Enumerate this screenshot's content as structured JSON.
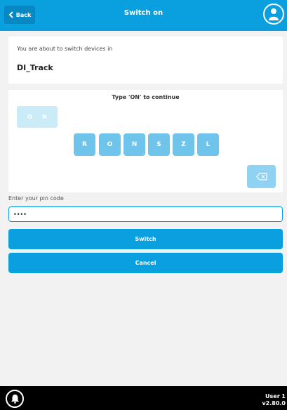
{
  "header": {
    "back_label": "Back",
    "title": "Switch on",
    "back_icon": "chevron-left-icon",
    "user_icon": "user-icon",
    "color": "#0aa0df"
  },
  "info": {
    "text": "You are about to switch devices in",
    "device": "DI_Track"
  },
  "code": {
    "title": "Type 'ON' to continue",
    "typed": [
      "O",
      "N"
    ],
    "keys": [
      "R",
      "O",
      "N",
      "S",
      "Z",
      "L"
    ],
    "backspace_icon": "backspace-icon"
  },
  "pin": {
    "label": "Enter your pin code",
    "value": "••••"
  },
  "actions": {
    "switch_label": "Switch",
    "cancel_label": "Cancel"
  },
  "footer": {
    "bell_icon": "bell-icon",
    "user": "User 1",
    "version": "v2.80.0"
  }
}
